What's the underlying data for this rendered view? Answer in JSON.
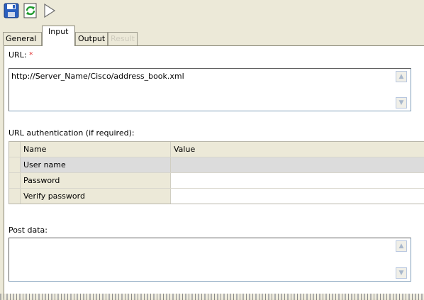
{
  "toolbar": {
    "save_icon": "save-disk-icon",
    "refresh_icon": "refresh-icon",
    "run_icon": "play-icon"
  },
  "tabs": [
    {
      "label": "General",
      "state": "normal"
    },
    {
      "label": "Input",
      "state": "active"
    },
    {
      "label": "Output",
      "state": "normal"
    },
    {
      "label": "Result",
      "state": "disabled"
    }
  ],
  "url": {
    "label": "URL:",
    "required_mark": "*",
    "value": "http://Server_Name/Cisco/address_book.xml"
  },
  "auth": {
    "label": "URL authentication (if required):",
    "columns": [
      "Name",
      "Value"
    ],
    "rows": [
      {
        "name": "User name",
        "value": ""
      },
      {
        "name": "Password",
        "value": ""
      },
      {
        "name": "Verify password",
        "value": ""
      }
    ]
  },
  "post": {
    "label": "Post data:",
    "value": ""
  },
  "colors": {
    "window_bg": "#ece9d8",
    "required": "#e03030",
    "selected_row": "#dcdcdc"
  }
}
